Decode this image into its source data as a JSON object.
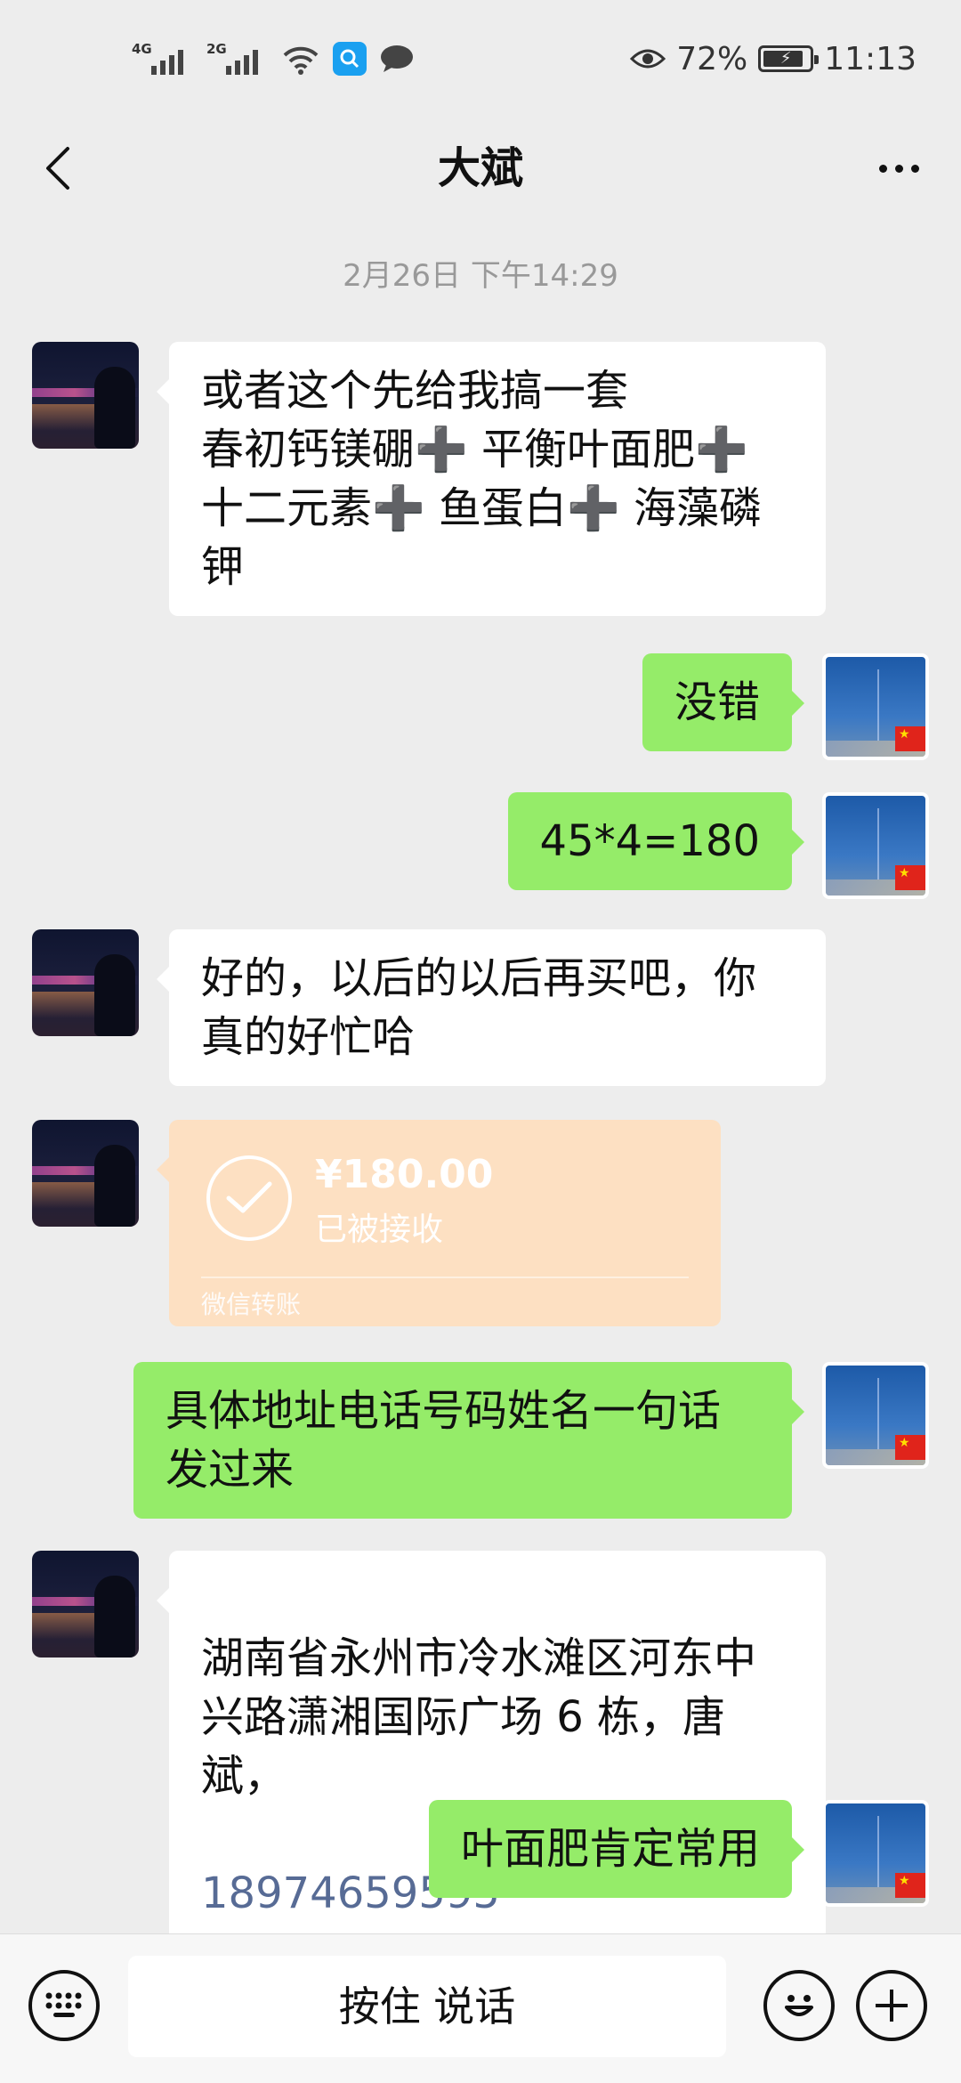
{
  "status_bar": {
    "network_1": "4G",
    "network_2": "2G",
    "battery_percent": "72%",
    "time": "11:13"
  },
  "nav": {
    "title": "大斌"
  },
  "chat": {
    "timestamp": "2月26日 下午14:29",
    "messages": [
      {
        "from": "them",
        "text": "或者这个先给我搞一套\n春初钙镁硼➕ 平衡叶面肥➕\n十二元素➕ 鱼蛋白➕ 海藻磷\n钾"
      },
      {
        "from": "me",
        "text": "没错"
      },
      {
        "from": "me",
        "text": "45*4=180"
      },
      {
        "from": "them",
        "text": "好的，以后的以后再买吧，你\n真的好忙哈"
      },
      {
        "from": "them",
        "type": "transfer",
        "amount": "¥180.00",
        "status": "已被接收",
        "label": "微信转账"
      },
      {
        "from": "me",
        "text": "具体地址电话号码姓名一句话\n发过来"
      },
      {
        "from": "them",
        "text": "湖南省永州市冷水滩区河东中\n兴路潇湘国际广场 6 栋，唐斌，",
        "phone": "18974659595"
      },
      {
        "from": "me",
        "text": "叶面肥肯定常用"
      }
    ]
  },
  "input_bar": {
    "talk_label": "按住 说话"
  },
  "icons": {
    "back": "chevron-left-icon",
    "more": "more-dots-icon",
    "keyboard": "keyboard-icon",
    "emoji": "emoji-icon",
    "plus": "plus-icon",
    "check": "check-icon"
  },
  "colors": {
    "background": "#ededed",
    "my_bubble": "#95ec69",
    "their_bubble": "#ffffff",
    "transfer_card": "#fde0c2",
    "link": "#576b95"
  }
}
